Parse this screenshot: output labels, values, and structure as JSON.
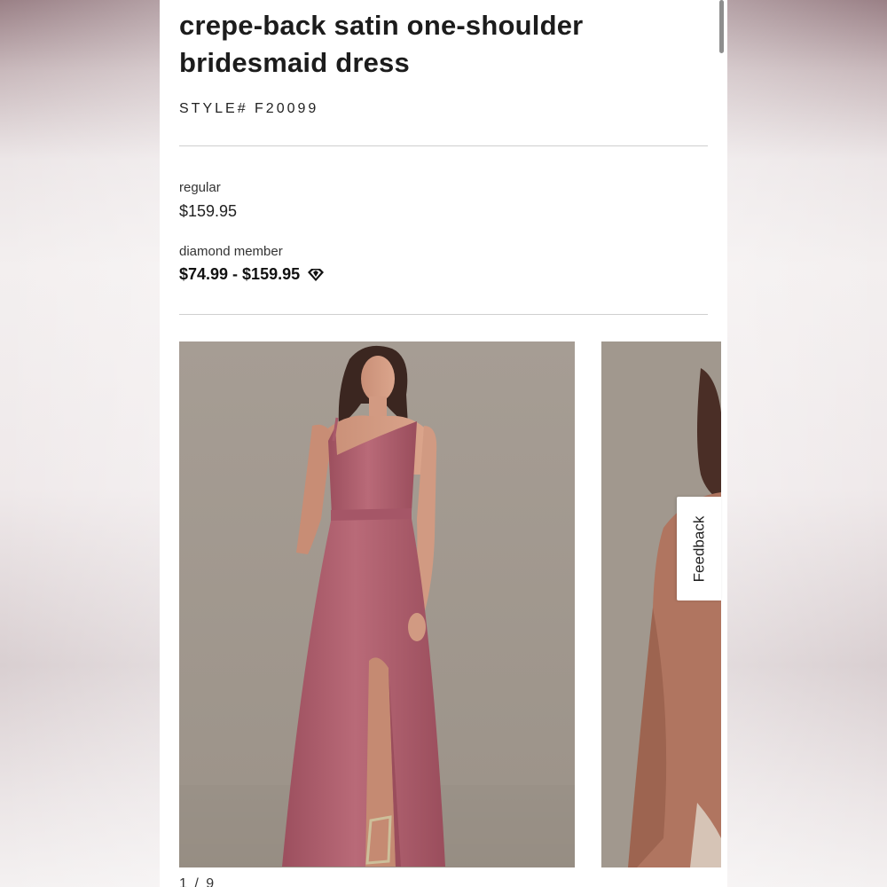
{
  "product": {
    "title": "crepe-back satin one-shoulder bridesmaid dress",
    "style_number": "STYLE# F20099"
  },
  "pricing": {
    "regular_label": "regular",
    "regular_price": "$159.95",
    "member_label": "diamond member",
    "member_price": "$74.99 - $159.95",
    "member_icon": "diamond-icon"
  },
  "gallery": {
    "pager": "1 / 9",
    "image_count": 9,
    "current_index": 1,
    "dress_color": "#b0606f",
    "backdrop_color": "#a1988e"
  },
  "feedback": {
    "label": "Feedback"
  }
}
